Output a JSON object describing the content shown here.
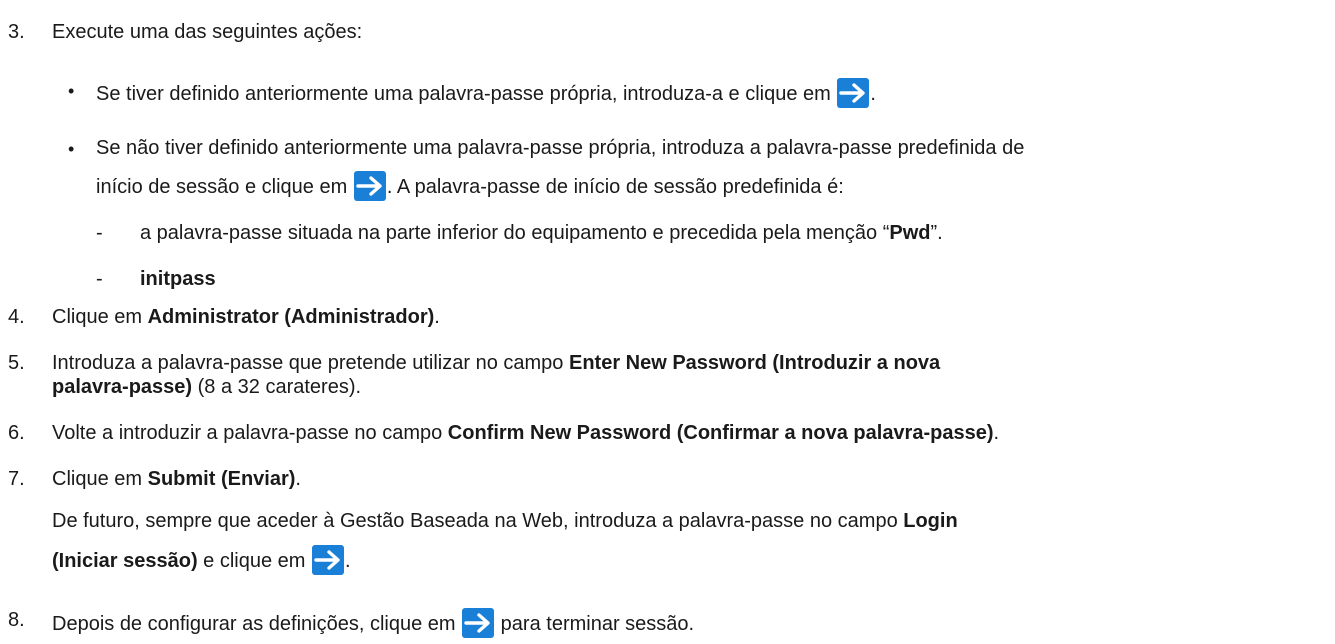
{
  "steps": {
    "s3": {
      "number": "3.",
      "text": "Execute uma das seguintes ações:",
      "bullet1": {
        "before": "Se tiver definido anteriormente uma palavra-passe própria, introduza-a e clique em ",
        "after": "."
      },
      "bullet2": {
        "line1": "Se não tiver definido anteriormente uma palavra-passe própria, introduza a palavra-passe predefinida de",
        "line2_before": "início de sessão e clique em ",
        "line2_after": ". A palavra-passe de início de sessão predefinida é:"
      },
      "sub1": {
        "before": "a palavra-passe situada na parte inferior do equipamento e precedida pela menção “",
        "bold": "Pwd",
        "after": "”."
      },
      "sub2": {
        "bold": "initpass"
      }
    },
    "s4": {
      "number": "4.",
      "before": "Clique em ",
      "bold": "Administrator (Administrador)",
      "after": "."
    },
    "s5": {
      "number": "5.",
      "before": "Introduza a palavra-passe que pretende utilizar no campo ",
      "bold1": "Enter New Password (Introduzir a nova",
      "bold2": "palavra-passe)",
      "after": " (8 a 32 carateres)."
    },
    "s6": {
      "number": "6.",
      "before": "Volte a introduzir a palavra-passe no campo ",
      "bold": "Confirm New Password (Confirmar a nova palavra-passe)",
      "after": "."
    },
    "s7": {
      "number": "7.",
      "before": "Clique em ",
      "bold": "Submit (Enviar)",
      "after": ".",
      "note_line1_before": "De futuro, sempre que aceder à Gestão Baseada na Web, introduza a palavra-passe no campo ",
      "note_line1_bold": "Login",
      "note_line2_bold": "(Iniciar sessão)",
      "note_line2_after": " e clique em ",
      "note_line2_end": "."
    },
    "s8": {
      "number": "8.",
      "before": "Depois de configurar as definições, clique em ",
      "after": " para terminar sessão."
    }
  },
  "symbols": {
    "bullet": "•",
    "dash": "-"
  },
  "colors": {
    "icon_bg": "#1a7fd6",
    "icon_fg": "#ffffff",
    "text": "#1a1a1a"
  }
}
